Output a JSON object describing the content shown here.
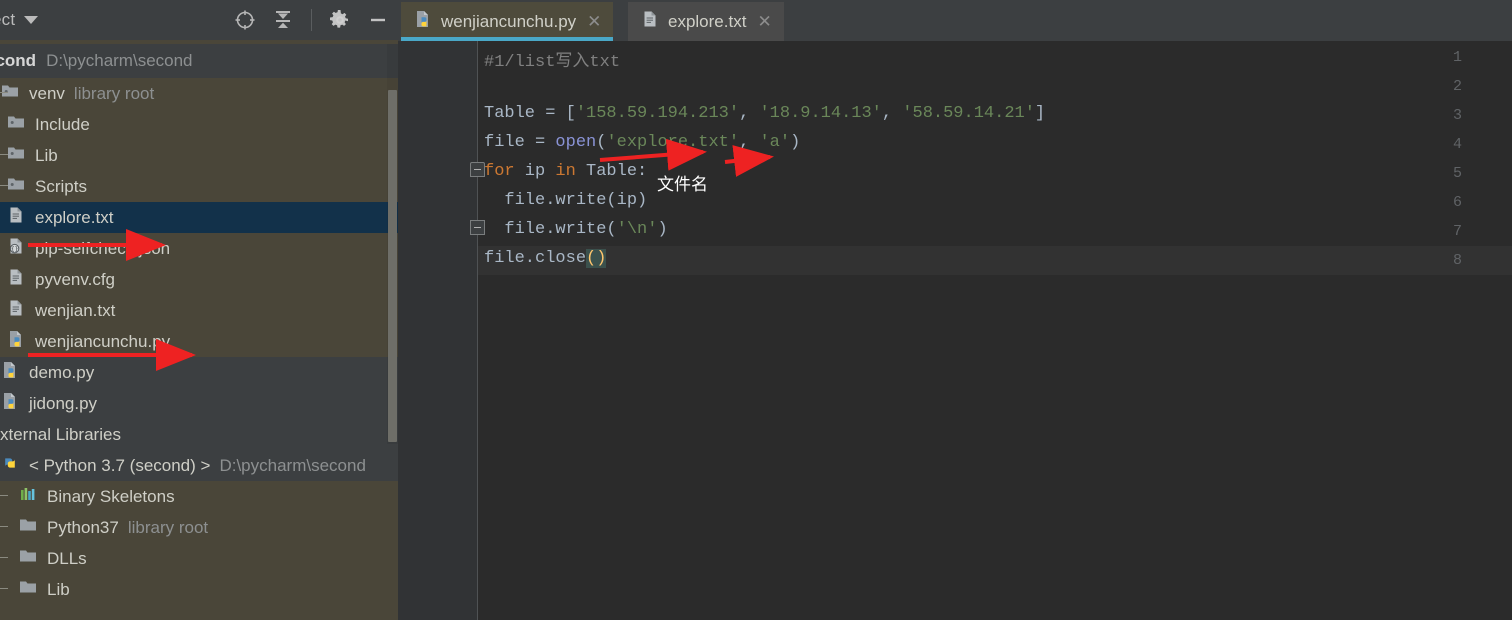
{
  "sidebar": {
    "tool_window_title": "ject",
    "caret_icon": "chevron-down-icon",
    "toolbar_icons": [
      {
        "name": "locate-target-icon",
        "label": "Select Opened File"
      },
      {
        "name": "collapse-all-icon",
        "label": "Collapse All"
      },
      {
        "name": "gear-icon",
        "label": "Settings"
      },
      {
        "name": "minimize-icon",
        "label": "Hide"
      }
    ],
    "project": {
      "name": "econd",
      "path": "D:\\pycharm\\second"
    },
    "tree": [
      {
        "label": "venv",
        "sub": "library root",
        "icon": "folder-icon",
        "indent": 0,
        "handle": true,
        "selected": false,
        "dark": false
      },
      {
        "label": "Include",
        "sub": "",
        "icon": "folder-icon",
        "indent": 1,
        "handle": false,
        "selected": false,
        "dark": false
      },
      {
        "label": "Lib",
        "sub": "",
        "icon": "folder-icon",
        "indent": 1,
        "handle": true,
        "selected": false,
        "dark": false
      },
      {
        "label": "Scripts",
        "sub": "",
        "icon": "folder-icon",
        "indent": 1,
        "handle": true,
        "selected": false,
        "dark": false
      },
      {
        "label": "explore.txt",
        "sub": "",
        "icon": "text-file-icon",
        "indent": 1,
        "handle": false,
        "selected": true,
        "dark": false
      },
      {
        "label": "pip-selfcheck.json",
        "sub": "",
        "icon": "json-file-icon",
        "indent": 1,
        "handle": false,
        "selected": false,
        "dark": false
      },
      {
        "label": "pyvenv.cfg",
        "sub": "",
        "icon": "text-file-icon",
        "indent": 1,
        "handle": false,
        "selected": false,
        "dark": false
      },
      {
        "label": "wenjian.txt",
        "sub": "",
        "icon": "text-file-icon",
        "indent": 1,
        "handle": false,
        "selected": false,
        "dark": false
      },
      {
        "label": "wenjiancunchu.py",
        "sub": "",
        "icon": "python-file-icon",
        "indent": 1,
        "handle": false,
        "selected": false,
        "dark": false
      },
      {
        "label": "demo.py",
        "sub": "",
        "icon": "python-file-icon",
        "indent": 0,
        "handle": false,
        "selected": false,
        "dark": true
      },
      {
        "label": "jidong.py",
        "sub": "",
        "icon": "python-file-icon",
        "indent": 0,
        "handle": false,
        "selected": false,
        "dark": true
      },
      {
        "label": "xternal Libraries",
        "sub": "",
        "icon": "none",
        "indent": 0,
        "handle": false,
        "selected": false,
        "dark": true
      },
      {
        "label": "< Python 3.7 (second) >",
        "sub": "D:\\pycharm\\second",
        "icon": "python-interpreter-icon",
        "indent": 0,
        "handle": false,
        "selected": false,
        "dark": true
      },
      {
        "label": "Binary Skeletons",
        "sub": "",
        "icon": "binary-skeletons-icon",
        "indent": 2,
        "handle": true,
        "selected": false,
        "dark": false
      },
      {
        "label": "Python37",
        "sub": "library root",
        "icon": "plain-folder-icon",
        "indent": 2,
        "handle": true,
        "selected": false,
        "dark": false
      },
      {
        "label": "DLLs",
        "sub": "",
        "icon": "plain-folder-icon",
        "indent": 2,
        "handle": true,
        "selected": false,
        "dark": false
      },
      {
        "label": "Lib",
        "sub": "",
        "icon": "plain-folder-icon",
        "indent": 2,
        "handle": true,
        "selected": false,
        "dark": false
      }
    ]
  },
  "editor": {
    "tabs": [
      {
        "label": "wenjiancunchu.py",
        "icon": "python-file-icon",
        "close_icon": "close-icon",
        "active": true
      },
      {
        "label": "explore.txt",
        "icon": "text-file-icon",
        "close_icon": "close-icon",
        "active": false
      }
    ],
    "line_numbers": [
      "1",
      "2",
      "3",
      "4",
      "5",
      "6",
      "7",
      "8"
    ],
    "current_line": 8,
    "code_lines": [
      {
        "n": 1,
        "text": "#1/list写入txt"
      },
      {
        "n": 2,
        "text": ""
      },
      {
        "n": 3,
        "text": "Table = ['158.59.194.213', '18.9.14.13', '58.59.14.21']"
      },
      {
        "n": 4,
        "text": "file = open('explore.txt', 'a')"
      },
      {
        "n": 5,
        "text": "for ip in Table:"
      },
      {
        "n": 6,
        "text": "  file.write(ip)"
      },
      {
        "n": 7,
        "text": "  file.write('\\n')"
      },
      {
        "n": 8,
        "text": "file.close()"
      }
    ]
  },
  "annotations": {
    "note_text": "文件名",
    "arrow_color": "#ee2222",
    "arrows": [
      {
        "name": "arrow-to-pip-selfcheck"
      },
      {
        "name": "arrow-to-wenjiancunchu"
      },
      {
        "name": "arrow-to-filename-argument"
      },
      {
        "name": "arrow-to-mode-argument"
      }
    ]
  },
  "colors": {
    "editor_background": "#2b2b2b",
    "gutter_background": "#313335",
    "sidebar_background": "#4a4639",
    "panel_background": "#3c3f41",
    "selection_background": "#12314a",
    "active_tab_underline": "#4aa8c7",
    "string_green": "#6a8759",
    "keyword_orange": "#cc7832",
    "comment_gray": "#808080",
    "default_text": "#a9b7c6"
  }
}
